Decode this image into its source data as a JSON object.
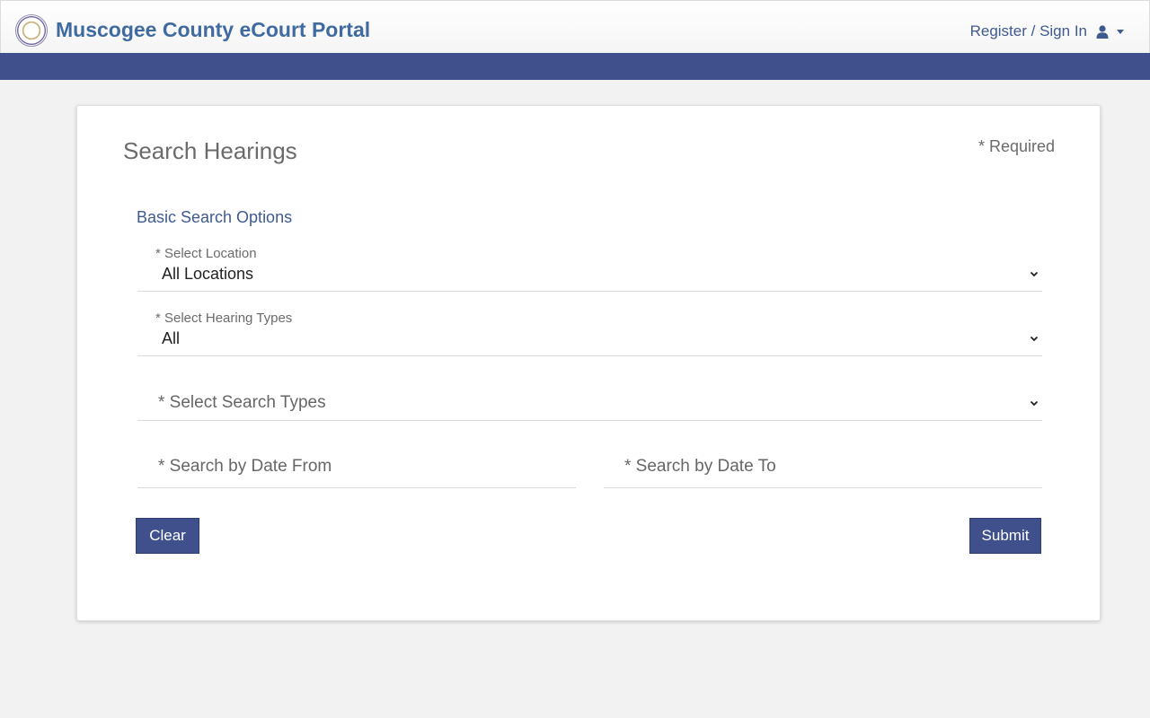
{
  "header": {
    "brand": "Muscogee County eCourt Portal",
    "user_menu_label": "Register / Sign In",
    "user_icon": "user-icon",
    "caret_icon": "caret-down-icon"
  },
  "colors": {
    "brand": "#3f6ba1",
    "nav_band": "#40508c",
    "button": "#40508c"
  },
  "form": {
    "title": "Search Hearings",
    "required_note": "* Required",
    "section_title": "Basic Search Options",
    "location": {
      "label": "* Select Location",
      "value": "All Locations"
    },
    "hearing_types": {
      "label": "* Select Hearing Types",
      "value": "All"
    },
    "search_types": {
      "placeholder": "* Select Search Types"
    },
    "date_from": {
      "placeholder": "* Search by Date From"
    },
    "date_to": {
      "placeholder": "* Search by Date To"
    },
    "clear_label": "Clear",
    "submit_label": "Submit"
  }
}
